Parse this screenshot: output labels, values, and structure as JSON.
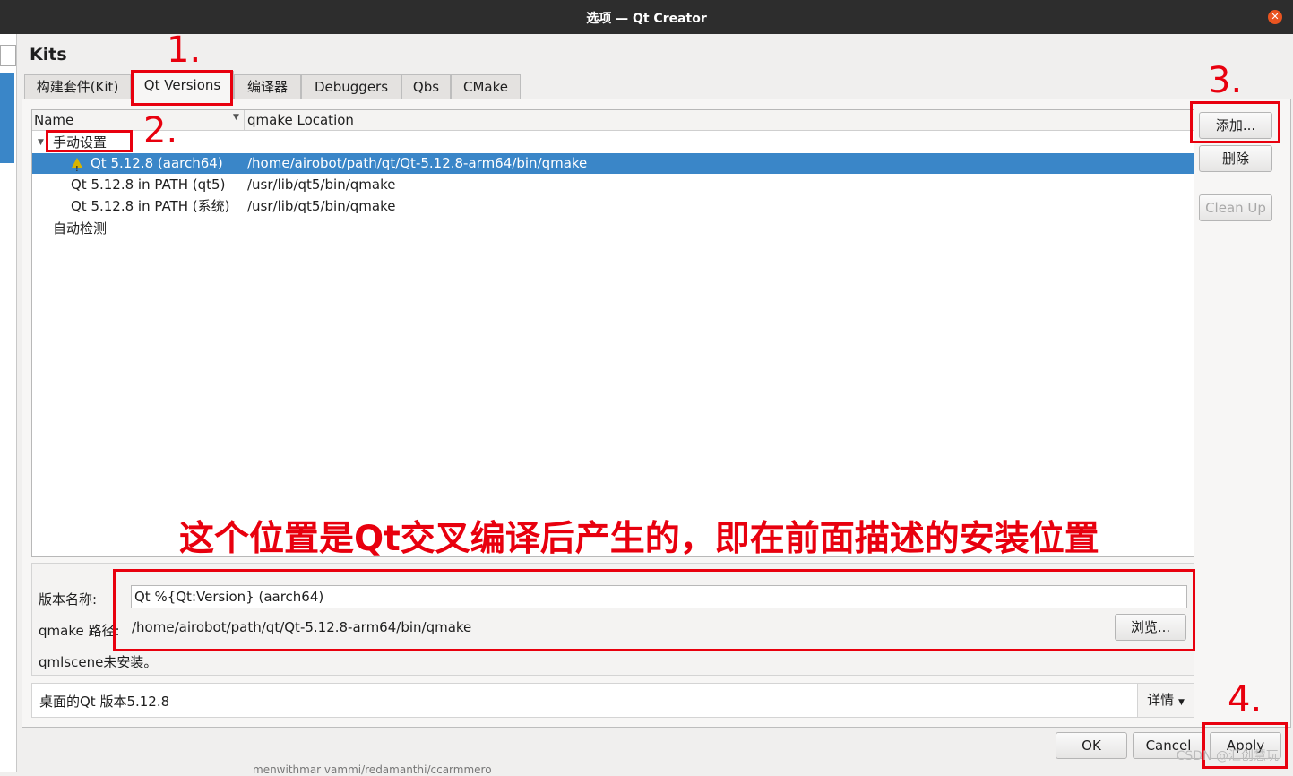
{
  "window": {
    "title": "选项 — Qt Creator"
  },
  "page": {
    "heading": "Kits"
  },
  "tabs": [
    {
      "label": "构建套件(Kit)"
    },
    {
      "label": "Qt Versions"
    },
    {
      "label": "编译器"
    },
    {
      "label": "Debuggers"
    },
    {
      "label": "Qbs"
    },
    {
      "label": "CMake"
    }
  ],
  "table": {
    "columns": [
      "Name",
      "qmake Location"
    ],
    "groups": [
      {
        "label": "手动设置",
        "items": [
          {
            "name": "Qt 5.12.8 (aarch64)",
            "location": "/home/airobot/path/qt/Qt-5.12.8-arm64/bin/qmake",
            "selected": true,
            "warning": true
          },
          {
            "name": "Qt 5.12.8 in PATH (qt5)",
            "location": "/usr/lib/qt5/bin/qmake"
          },
          {
            "name": "Qt 5.12.8 in PATH (系统)",
            "location": "/usr/lib/qt5/bin/qmake"
          }
        ]
      },
      {
        "label": "自动检测",
        "items": []
      }
    ]
  },
  "side_buttons": {
    "add": "添加...",
    "remove": "删除",
    "cleanup": "Clean Up"
  },
  "details": {
    "version_label": "版本名称:",
    "version_value": "Qt %{Qt:Version} (aarch64)",
    "qmake_label": "qmake 路径:",
    "qmake_value": "/home/airobot/path/qt/Qt-5.12.8-arm64/bin/qmake",
    "browse": "浏览...",
    "qmlscene": "qmlscene未安装。"
  },
  "summary": {
    "text": "桌面的Qt 版本5.12.8",
    "details": "详情"
  },
  "dialog_buttons": {
    "ok": "OK",
    "cancel": "Cancel",
    "apply": "Apply"
  },
  "background_text": "menwithmar vammi/redamanthi/ccarmmero",
  "annotations": {
    "n1": "1.",
    "n2": "2.",
    "n3": "3.",
    "n4": "4.",
    "note": "这个位置是Qt交叉编译后产生的，即在前面描述的安装位置"
  },
  "watermark": "CSDN @汇创慧玩",
  "colors": {
    "annotation": "#e8000e",
    "selection": "#3a86c8",
    "titlebar": "#2d2d2d"
  }
}
